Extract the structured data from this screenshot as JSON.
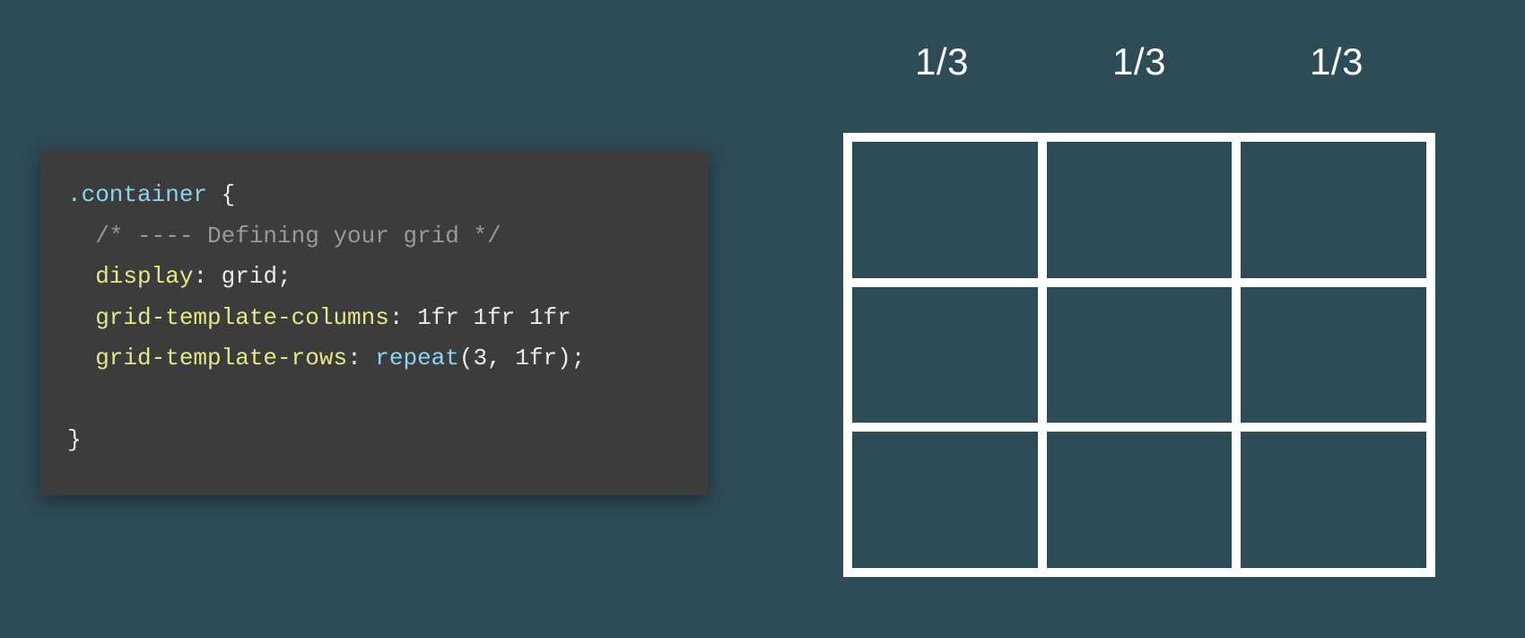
{
  "code": {
    "selector": ".container",
    "open_brace": " {",
    "comment": "  /* ---- Defining your grid */",
    "prop1": "  display",
    "val1": " grid",
    "prop2": "  grid-template-columns",
    "val2": " 1fr 1fr 1fr",
    "prop3": "  grid-template-rows",
    "func3": " repeat",
    "args3": "(3, 1fr)",
    "close_brace": "}"
  },
  "diagram": {
    "col_labels": [
      "1/3",
      "1/3",
      "1/3"
    ]
  }
}
